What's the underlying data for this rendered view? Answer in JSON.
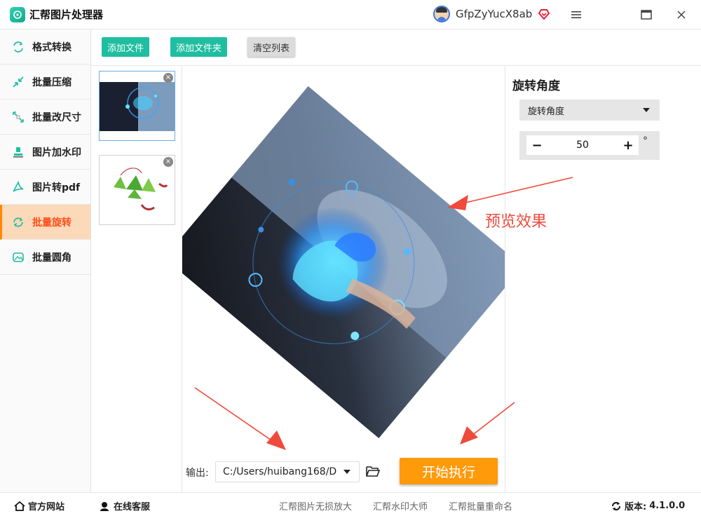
{
  "app": {
    "title": "汇帮图片处理器",
    "username": "GfpZyYucX8ab"
  },
  "window_controls": {
    "menu": "≡",
    "maximize": "▭",
    "close": "✕"
  },
  "sidebar": {
    "items": [
      {
        "label": "格式转换",
        "icon": "format-convert-icon"
      },
      {
        "label": "批量压缩",
        "icon": "compress-icon"
      },
      {
        "label": "批量改尺寸",
        "icon": "resize-icon"
      },
      {
        "label": "图片加水印",
        "icon": "watermark-icon"
      },
      {
        "label": "图片转pdf",
        "icon": "pdf-icon"
      },
      {
        "label": "批量旋转",
        "icon": "rotate-icon",
        "active": true
      },
      {
        "label": "批量圆角",
        "icon": "round-corner-icon"
      }
    ]
  },
  "toolbar": {
    "add_file": "添加文件",
    "add_folder": "添加文件夹",
    "clear_list": "清空列表"
  },
  "thumbnails": {
    "close": "×",
    "count": 2
  },
  "right_panel": {
    "title": "旋转角度",
    "select_value": "旋转角度",
    "stepper": {
      "minus": "−",
      "value": "50",
      "plus": "+",
      "unit": "°"
    }
  },
  "annotation": {
    "text": "预览效果"
  },
  "output": {
    "label": "输出:",
    "path": "C:/Users/huibang168/D",
    "start": "开始执行"
  },
  "footer": {
    "website": "官方网站",
    "service": "在线客服",
    "links": [
      "汇帮图片无损放大",
      "汇帮水印大师",
      "汇帮批量重命名"
    ],
    "version_label": "版本:",
    "version": "4.1.0.0"
  },
  "colors": {
    "accent": "#1fbea0",
    "active_bg": "#fbd9b9",
    "active_text": "#ff4d1a",
    "start": "#ff9a0a",
    "annotation": "#ef4a3c"
  }
}
